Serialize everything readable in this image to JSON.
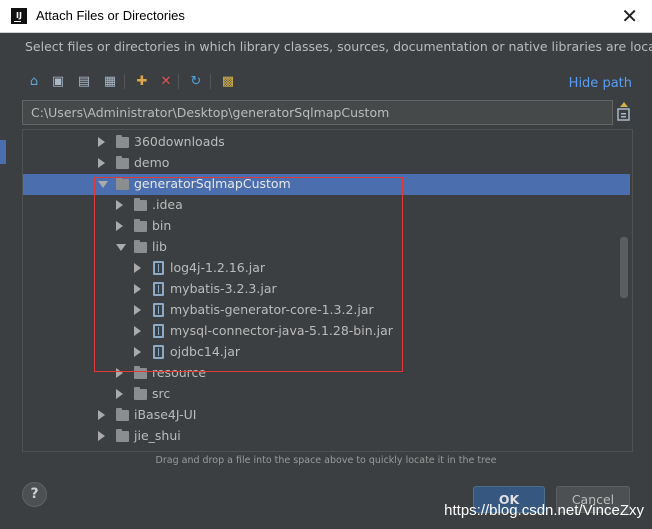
{
  "window": {
    "title": "Attach Files or Directories",
    "app_icon": "IJ"
  },
  "description": "Select files or directories in which library classes, sources, documentation or native libraries are located",
  "toolbar": {
    "buttons": [
      {
        "name": "home-icon",
        "glyph": "⌂",
        "color": "#5fa8d8"
      },
      {
        "name": "desktop-icon",
        "glyph": "▣",
        "color": "#a9b7c6"
      },
      {
        "name": "project-icon",
        "glyph": "▤",
        "color": "#a9b7c6"
      },
      {
        "name": "module-icon",
        "glyph": "▦",
        "color": "#a9b7c6"
      },
      {
        "name": "new-folder-icon",
        "glyph": "✚",
        "color": "#e0a64a"
      },
      {
        "name": "delete-icon",
        "glyph": "✕",
        "color": "#e05454"
      },
      {
        "name": "refresh-icon",
        "glyph": "↻",
        "color": "#4aa3df"
      },
      {
        "name": "show-hidden-icon",
        "glyph": "▩",
        "color": "#d4b24a"
      }
    ],
    "hide_path_label": "Hide path"
  },
  "path_value": "C:\\Users\\Administrator\\Desktop\\generatorSqlmapCustom",
  "tree": {
    "items": [
      {
        "label": "360downloads",
        "kind": "folder",
        "arrow": "right",
        "depth": 0,
        "selected": false
      },
      {
        "label": "demo",
        "kind": "folder",
        "arrow": "right",
        "depth": 0,
        "selected": false
      },
      {
        "label": "generatorSqlmapCustom",
        "kind": "folder",
        "arrow": "down",
        "depth": 0,
        "selected": true
      },
      {
        "label": ".idea",
        "kind": "folder",
        "arrow": "right",
        "depth": 1,
        "selected": false
      },
      {
        "label": "bin",
        "kind": "folder",
        "arrow": "right",
        "depth": 1,
        "selected": false
      },
      {
        "label": "lib",
        "kind": "folder",
        "arrow": "down",
        "depth": 1,
        "selected": false
      },
      {
        "label": "log4j-1.2.16.jar",
        "kind": "jar",
        "arrow": "right",
        "depth": 2,
        "selected": false
      },
      {
        "label": "mybatis-3.2.3.jar",
        "kind": "jar",
        "arrow": "right",
        "depth": 2,
        "selected": false
      },
      {
        "label": "mybatis-generator-core-1.3.2.jar",
        "kind": "jar",
        "arrow": "right",
        "depth": 2,
        "selected": false
      },
      {
        "label": "mysql-connector-java-5.1.28-bin.jar",
        "kind": "jar",
        "arrow": "right",
        "depth": 2,
        "selected": false
      },
      {
        "label": "ojdbc14.jar",
        "kind": "jar",
        "arrow": "right",
        "depth": 2,
        "selected": false
      },
      {
        "label": "resource",
        "kind": "folder",
        "arrow": "right",
        "depth": 1,
        "selected": false
      },
      {
        "label": "src",
        "kind": "folder",
        "arrow": "right",
        "depth": 1,
        "selected": false
      },
      {
        "label": "iBase4J-UI",
        "kind": "folder",
        "arrow": "right",
        "depth": 0,
        "selected": false
      },
      {
        "label": "jie_shui",
        "kind": "folder",
        "arrow": "right",
        "depth": 0,
        "selected": false
      }
    ]
  },
  "hint": "Drag and drop a file into the space above to quickly locate it in the tree",
  "buttons": {
    "help": "?",
    "ok": "OK",
    "cancel": "Cancel"
  },
  "watermark": "https://blog.csdn.net/VinceZxy",
  "colors": {
    "selection": "#4b6eaf",
    "highlight_box": "#e23838",
    "link": "#589df6"
  }
}
